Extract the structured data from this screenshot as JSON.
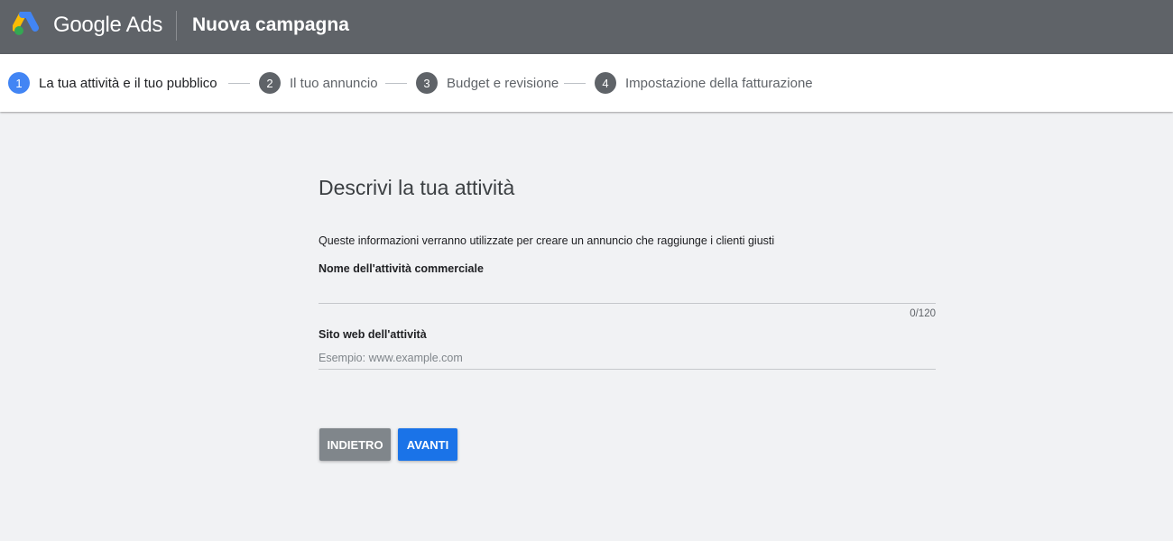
{
  "header": {
    "brand": "Google Ads",
    "title": "Nuova campagna"
  },
  "stepper": {
    "steps": [
      {
        "number": "1",
        "label": "La tua attività e il tuo pubblico",
        "active": true
      },
      {
        "number": "2",
        "label": "Il tuo annuncio",
        "active": false
      },
      {
        "number": "3",
        "label": "Budget e revisione",
        "active": false
      },
      {
        "number": "4",
        "label": "Impostazione della fatturazione",
        "active": false
      }
    ]
  },
  "form": {
    "title": "Descrivi la tua attività",
    "description": "Queste informazioni verranno utilizzate per creare un annuncio che raggiunge i clienti giusti",
    "business_name": {
      "label": "Nome dell'attività commerciale",
      "value": "",
      "counter": "0/120"
    },
    "website": {
      "label": "Sito web dell'attività",
      "placeholder": "Esempio: www.example.com",
      "value": ""
    }
  },
  "buttons": {
    "back": "INDIETRO",
    "next": "AVANTI"
  },
  "colors": {
    "header_bg": "#5f6368",
    "active_step": "#4285f4",
    "primary_button": "#1a73e8",
    "secondary_button": "#80868b",
    "page_bg": "#f1f2f4"
  }
}
